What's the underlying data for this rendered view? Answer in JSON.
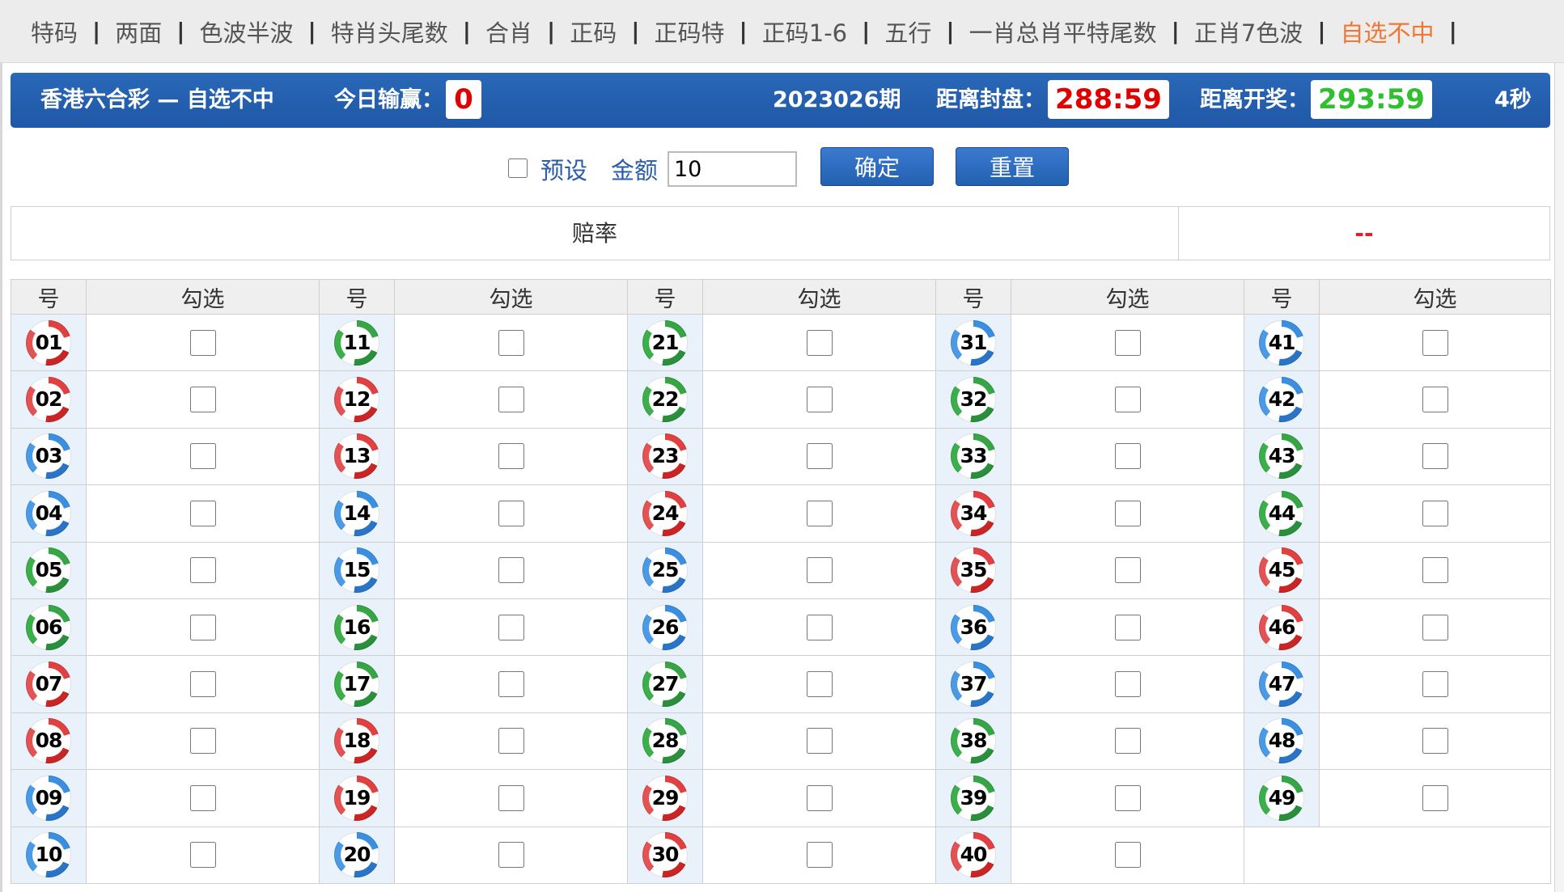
{
  "nav": {
    "items": [
      "特码",
      "两面",
      "色波半波",
      "特肖头尾数",
      "合肖",
      "正码",
      "正码特",
      "正码1-6",
      "五行",
      "一肖总肖平特尾数",
      "正肖7色波",
      "自选不中"
    ],
    "active": "自选不中",
    "separator": "|"
  },
  "header": {
    "title": "香港六合彩 — 自选不中",
    "winloss_label": "今日输赢：",
    "winloss_value": "0",
    "period": "2023026期",
    "close_label": "距离封盘：",
    "close_time": "288:59",
    "draw_label": "距离开奖：",
    "draw_time": "293:59",
    "refresh": "4秒"
  },
  "controls": {
    "preset_label": "预设",
    "preset_checked": false,
    "amount_label": "金额",
    "amount_value": "10",
    "confirm_label": "确定",
    "reset_label": "重置"
  },
  "odds": {
    "label": "赔率",
    "value": "--"
  },
  "table": {
    "col_number": "号",
    "col_select": "勾选",
    "numbers": [
      {
        "n": "01",
        "color": "red"
      },
      {
        "n": "02",
        "color": "red"
      },
      {
        "n": "03",
        "color": "blue"
      },
      {
        "n": "04",
        "color": "blue"
      },
      {
        "n": "05",
        "color": "green"
      },
      {
        "n": "06",
        "color": "green"
      },
      {
        "n": "07",
        "color": "red"
      },
      {
        "n": "08",
        "color": "red"
      },
      {
        "n": "09",
        "color": "blue"
      },
      {
        "n": "10",
        "color": "blue"
      },
      {
        "n": "11",
        "color": "green"
      },
      {
        "n": "12",
        "color": "red"
      },
      {
        "n": "13",
        "color": "red"
      },
      {
        "n": "14",
        "color": "blue"
      },
      {
        "n": "15",
        "color": "blue"
      },
      {
        "n": "16",
        "color": "green"
      },
      {
        "n": "17",
        "color": "green"
      },
      {
        "n": "18",
        "color": "red"
      },
      {
        "n": "19",
        "color": "red"
      },
      {
        "n": "20",
        "color": "blue"
      },
      {
        "n": "21",
        "color": "green"
      },
      {
        "n": "22",
        "color": "green"
      },
      {
        "n": "23",
        "color": "red"
      },
      {
        "n": "24",
        "color": "red"
      },
      {
        "n": "25",
        "color": "blue"
      },
      {
        "n": "26",
        "color": "blue"
      },
      {
        "n": "27",
        "color": "green"
      },
      {
        "n": "28",
        "color": "green"
      },
      {
        "n": "29",
        "color": "red"
      },
      {
        "n": "30",
        "color": "red"
      },
      {
        "n": "31",
        "color": "blue"
      },
      {
        "n": "32",
        "color": "green"
      },
      {
        "n": "33",
        "color": "green"
      },
      {
        "n": "34",
        "color": "red"
      },
      {
        "n": "35",
        "color": "red"
      },
      {
        "n": "36",
        "color": "blue"
      },
      {
        "n": "37",
        "color": "blue"
      },
      {
        "n": "38",
        "color": "green"
      },
      {
        "n": "39",
        "color": "green"
      },
      {
        "n": "40",
        "color": "red"
      },
      {
        "n": "41",
        "color": "blue"
      },
      {
        "n": "42",
        "color": "blue"
      },
      {
        "n": "43",
        "color": "green"
      },
      {
        "n": "44",
        "color": "green"
      },
      {
        "n": "45",
        "color": "red"
      },
      {
        "n": "46",
        "color": "red"
      },
      {
        "n": "47",
        "color": "blue"
      },
      {
        "n": "48",
        "color": "blue"
      },
      {
        "n": "49",
        "color": "green"
      }
    ]
  },
  "colors": {
    "accent_blue": "#1f58a6",
    "active_tab": "#ee7733",
    "alert_red": "#e02020",
    "timer_green": "#2fbf2f"
  }
}
